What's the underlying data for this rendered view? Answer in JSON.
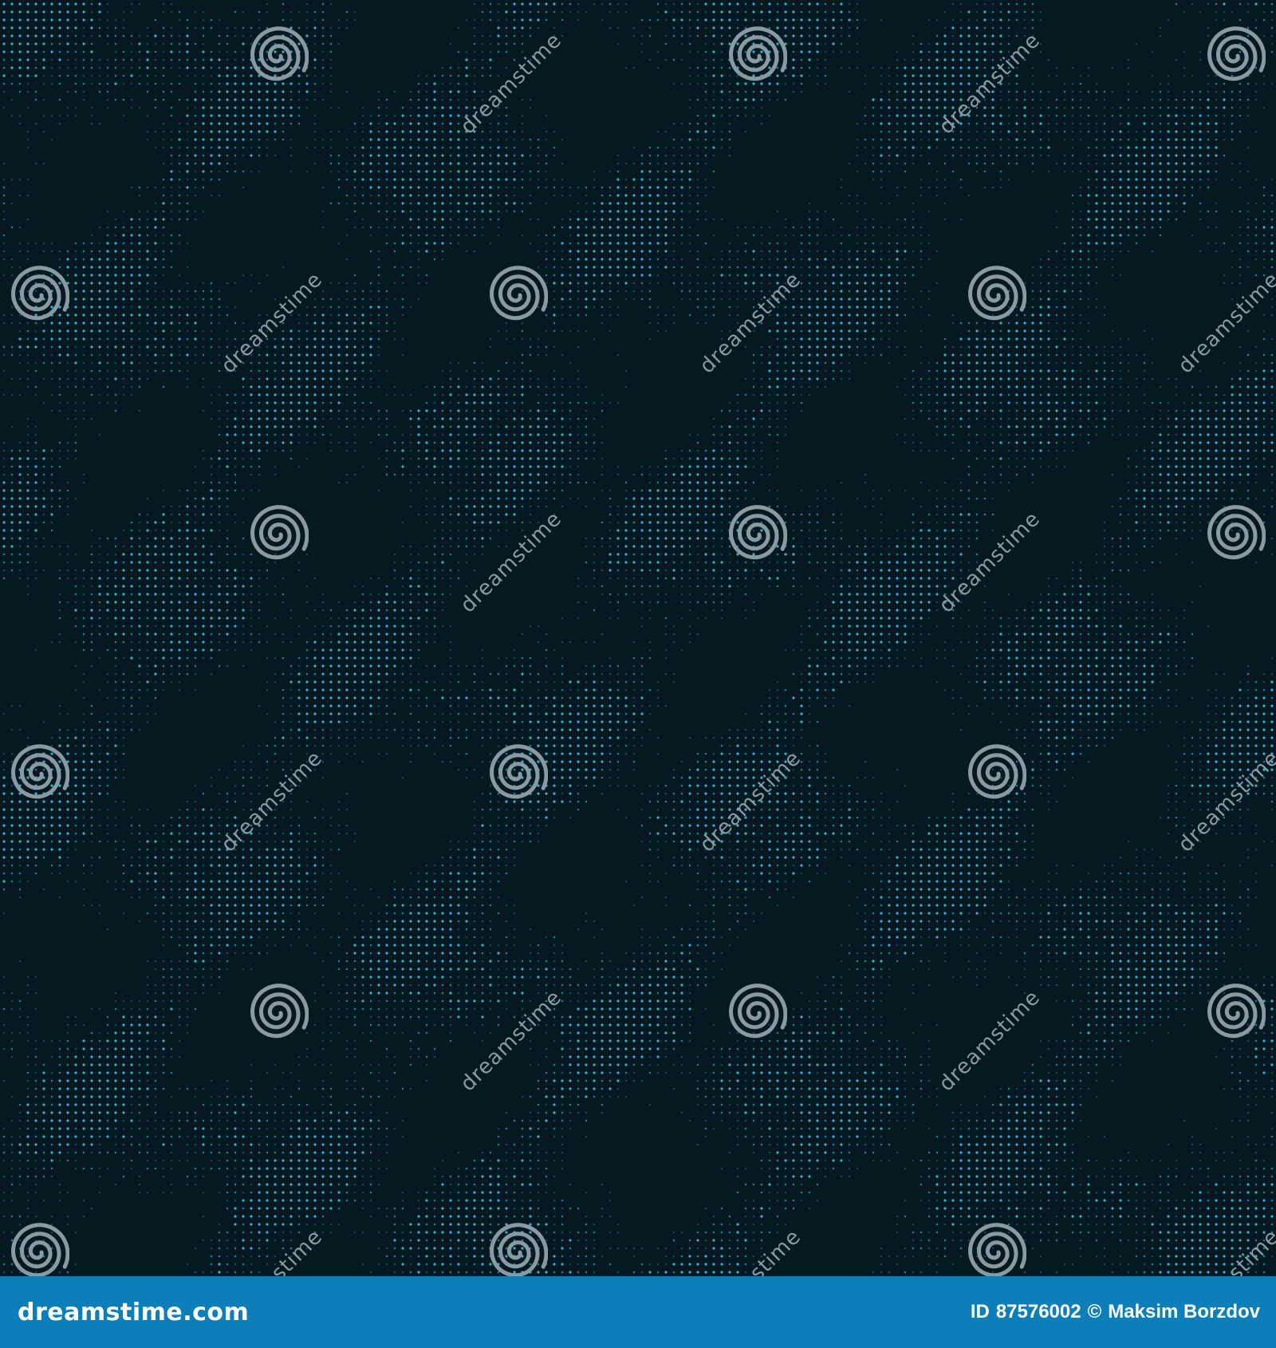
{
  "image": {
    "description_colors": {
      "background": "#061820",
      "dot_bright": "#2fb6d8",
      "dot_mid": "#1f7f9a",
      "dot_dim": "#12495a",
      "watermark": "#8a9aa2",
      "footer_background": "#0d7fb8",
      "footer_text": "#ffffff"
    }
  },
  "watermark": {
    "text": "dreamstime",
    "icon": "dreamstime-spiral-icon"
  },
  "footer": {
    "brand_text": "dreamstime.com",
    "id_label": "ID",
    "id_value": "87576002",
    "copyright_symbol": "©",
    "author": "Maksim Borzdov"
  }
}
